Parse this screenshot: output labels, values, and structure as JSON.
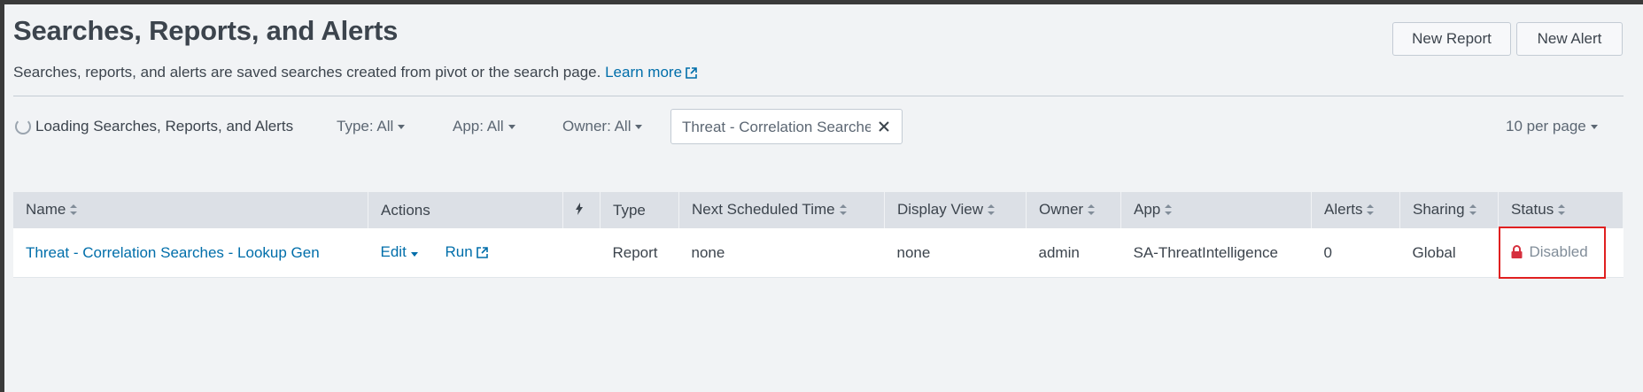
{
  "header": {
    "title": "Searches, Reports, and Alerts",
    "description": "Searches, reports, and alerts are saved searches created from pivot or the search page.",
    "learn_more": "Learn more",
    "new_report": "New Report",
    "new_alert": "New Alert"
  },
  "toolbar": {
    "loading": "Loading Searches, Reports, and Alerts",
    "type_filter": "Type: All",
    "app_filter": "App: All",
    "owner_filter": "Owner: All",
    "search_value": "Threat - Correlation Searches",
    "per_page": "10 per page"
  },
  "table": {
    "columns": [
      "Name",
      "Actions",
      "",
      "Type",
      "Next Scheduled Time",
      "Display View",
      "Owner",
      "App",
      "Alerts",
      "Sharing",
      "Status"
    ],
    "rows": [
      {
        "name": "Threat - Correlation Searches - Lookup Gen",
        "edit": "Edit",
        "run": "Run",
        "type": "Report",
        "next_scheduled": "none",
        "display_view": "none",
        "owner": "admin",
        "app": "SA-ThreatIntelligence",
        "alerts": "0",
        "sharing": "Global",
        "status": "Disabled"
      }
    ]
  },
  "colors": {
    "link": "#006eaa",
    "highlight": "#e02020",
    "lock": "#d6303e"
  }
}
